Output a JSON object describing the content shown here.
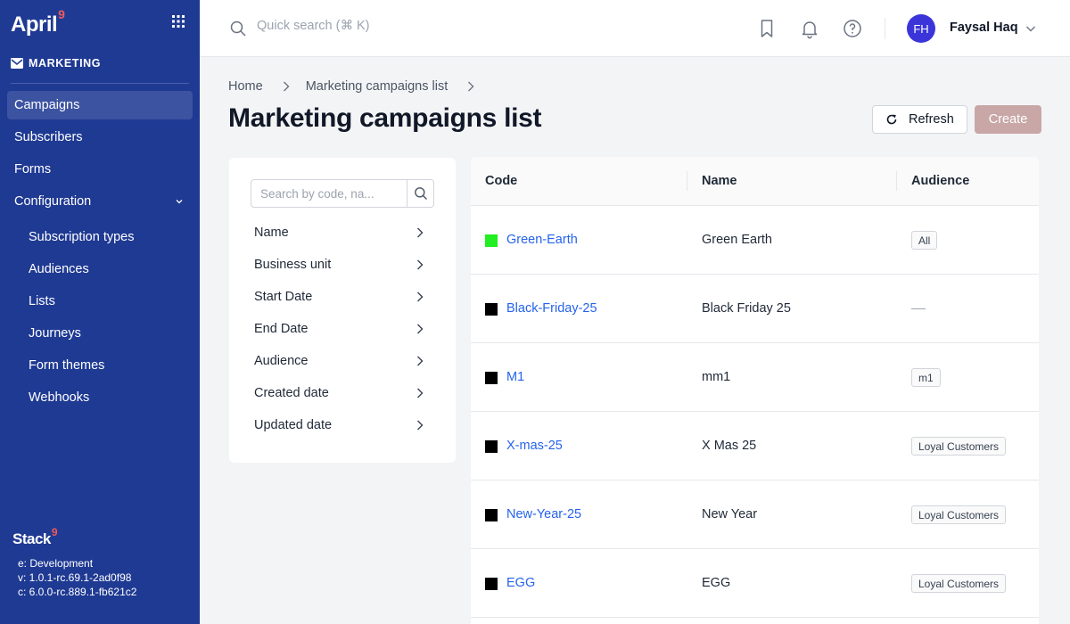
{
  "app": {
    "logo_text": "April",
    "logo_sup": "9",
    "section": "MARKETING"
  },
  "sidebar": {
    "items": [
      {
        "label": "Campaigns",
        "active": true
      },
      {
        "label": "Subscribers"
      },
      {
        "label": "Forms"
      },
      {
        "label": "Configuration",
        "expanded": true
      }
    ],
    "sub_items": [
      {
        "label": "Subscription types"
      },
      {
        "label": "Audiences"
      },
      {
        "label": "Lists"
      },
      {
        "label": "Journeys"
      },
      {
        "label": "Form themes"
      },
      {
        "label": "Webhooks"
      }
    ],
    "footer": {
      "stack_text": "Stack",
      "stack_sup": "9",
      "env": "e: Development",
      "version": "v: 1.0.1-rc.69.1-2ad0f98",
      "core": "c: 6.0.0-rc.889.1-fb621c2"
    }
  },
  "topbar": {
    "search_placeholder": "Quick search (⌘ K)",
    "icons": [
      "bookmark-icon",
      "bell-icon",
      "help-icon"
    ],
    "user": {
      "initials": "FH",
      "name": "Faysal Haq"
    }
  },
  "header": {
    "breadcrumb": [
      "Home",
      "Marketing campaigns list"
    ],
    "title": "Marketing campaigns list",
    "refresh_label": "Refresh",
    "create_label": "Create"
  },
  "filters": {
    "search_placeholder": "Search by code, na...",
    "items": [
      "Name",
      "Business unit",
      "Start Date",
      "End Date",
      "Audience",
      "Created date",
      "Updated date"
    ]
  },
  "table": {
    "columns": [
      "Code",
      "Name",
      "Audience"
    ],
    "rows": [
      {
        "color": "#22ee22",
        "code": "Green-Earth",
        "name": "Green Earth",
        "audience": "All"
      },
      {
        "color": "#000000",
        "code": "Black-Friday-25",
        "name": "Black Friday 25",
        "audience": ""
      },
      {
        "color": "#000000",
        "code": "M1",
        "name": "mm1",
        "audience": "m1"
      },
      {
        "color": "#000000",
        "code": "X-mas-25",
        "name": "X Mas 25",
        "audience": "Loyal Customers"
      },
      {
        "color": "#000000",
        "code": "New-Year-25",
        "name": "New Year",
        "audience": "Loyal Customers"
      },
      {
        "color": "#000000",
        "code": "EGG",
        "name": "EGG",
        "audience": "Loyal Customers"
      }
    ]
  },
  "colors": {
    "sidebar_bg": "#1f3a93",
    "link": "#2563eb",
    "create_button": "#c9a7a7",
    "avatar": "#3b35d9"
  }
}
